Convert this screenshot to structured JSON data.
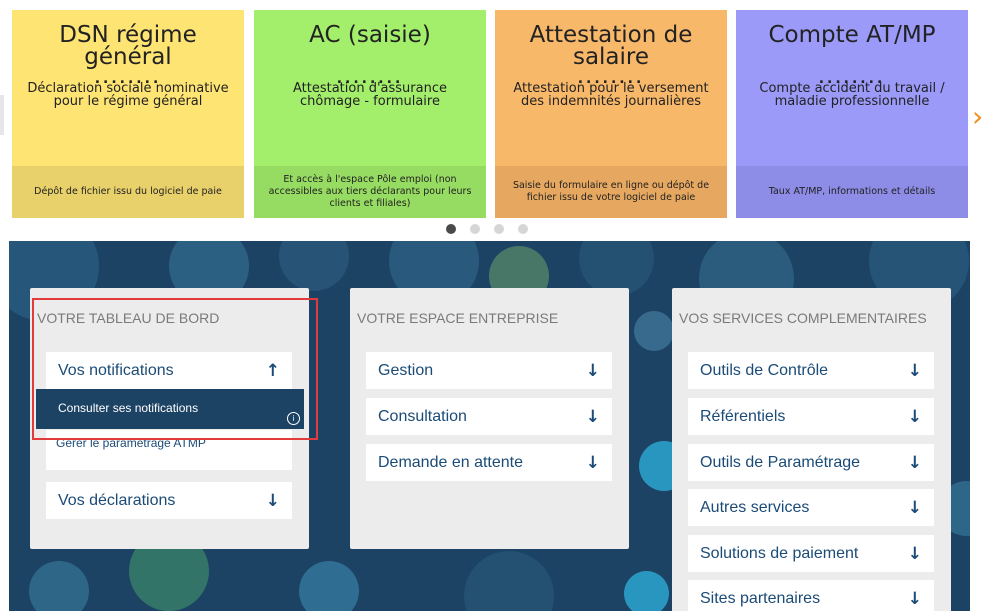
{
  "carousel": {
    "cards": [
      {
        "title_line1": "DSN régime",
        "title_line2": "général",
        "subtitle_line1": "Déclaration sociale nominative",
        "subtitle_line2": "pour le régime général",
        "footer": "Dépôt de fichier issu du logiciel de paie",
        "color": "#fde473",
        "footer_color": "#e8d06a"
      },
      {
        "title_line1": "AC (saisie)",
        "title_line2": "",
        "subtitle_line1": "Attestation d'assurance",
        "subtitle_line2": "chômage - formulaire",
        "footer": "Et accès à l'espace Pôle emploi (non accessibles aux tiers déclarants pour leurs clients et filiales)",
        "color": "#a3ee6b",
        "footer_color": "#97dc62"
      },
      {
        "title_line1": "Attestation de",
        "title_line2": "salaire",
        "subtitle_line1": "Attestation pour le versement",
        "subtitle_line2": "des indemnités journalières",
        "footer": "Saisie du formulaire en ligne ou dépôt de fichier issu de votre logiciel de paie",
        "color": "#f8b86a",
        "footer_color": "#e6a860"
      },
      {
        "title_line1": "Compte AT/MP",
        "title_line2": "",
        "subtitle_line1": "Compte accident du travail /",
        "subtitle_line2": "maladie professionnelle",
        "footer": "Taux AT/MP, informations et détails",
        "color": "#9b9af9",
        "footer_color": "#8d8ce6"
      }
    ],
    "dots_text": "........",
    "right_arrow": "›",
    "page_count": 4,
    "active_page": 1
  },
  "dashboard": {
    "background": "#1c4264",
    "tableau": {
      "heading": "VOTRE TABLEAU DE BORD",
      "notifications_label": "Vos notifications",
      "notifications_icon": "arrow-up-icon",
      "sub_active": "Consulter ses notifications",
      "info_icon": "i",
      "sub_plain": "Gérer le paramétrage ATMP",
      "declarations_label": "Vos déclarations"
    },
    "entreprise": {
      "heading": "VOTRE ESPACE ENTREPRISE",
      "items": [
        "Gestion",
        "Consultation",
        "Demande en attente"
      ]
    },
    "services": {
      "heading": "VOS SERVICES COMPLEMENTAIRES",
      "items": [
        "Outils de Contrôle",
        "Référentiels",
        "Outils de Paramétrage",
        "Autres services",
        "Solutions de paiement",
        "Sites partenaires"
      ]
    },
    "arrow_up": "↑",
    "arrow_down": "↓"
  },
  "highlight_color": "#e23b3b"
}
